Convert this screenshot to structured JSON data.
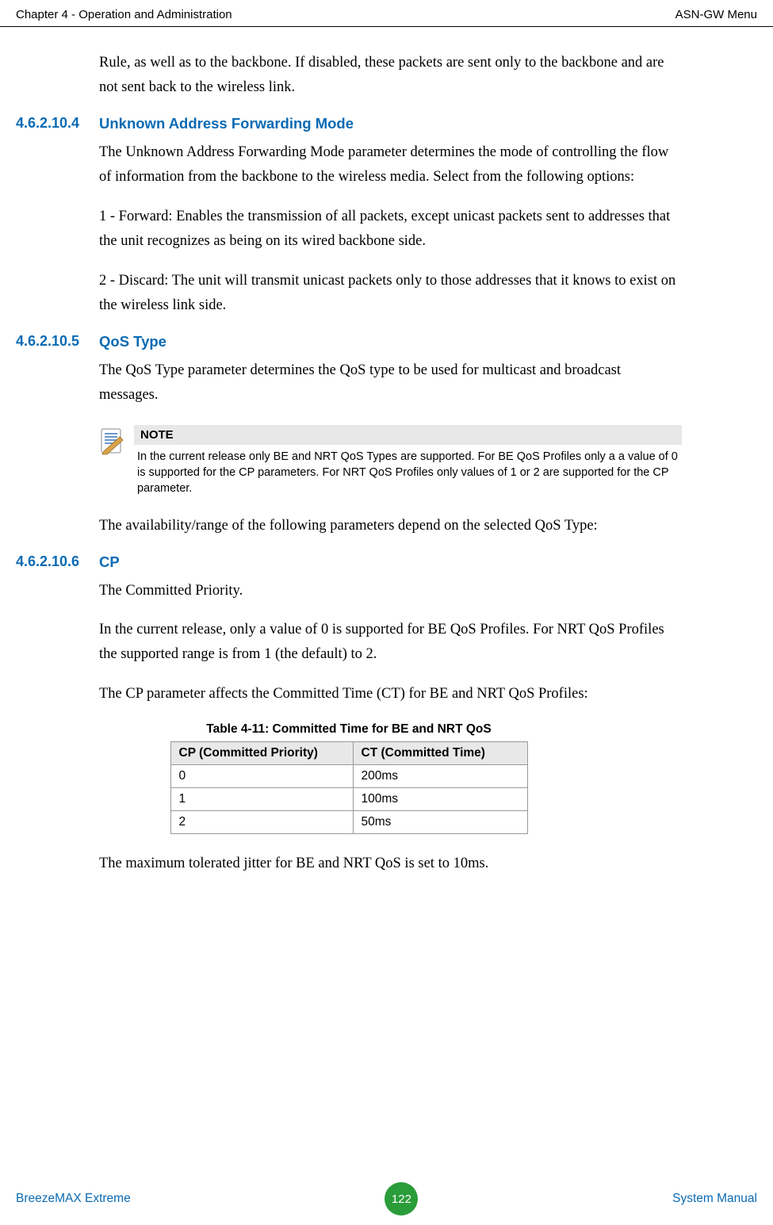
{
  "header": {
    "left": "Chapter 4 - Operation and Administration",
    "right": "ASN-GW Menu"
  },
  "intro_para": "Rule, as well as to the backbone. If disabled, these packets are sent only to the backbone and are not sent back to the wireless link.",
  "sections": {
    "s4": {
      "num": "4.6.2.10.4",
      "title": "Unknown Address Forwarding Mode",
      "p1": "The Unknown Address Forwarding Mode parameter determines the mode of controlling the flow of information from the backbone to the wireless media. Select from the following options:",
      "p2": "1 - Forward: Enables the transmission of all packets, except unicast packets sent to addresses that the unit recognizes as being on its wired backbone side.",
      "p3": "2 - Discard: The unit will transmit unicast packets only to those addresses that it knows to exist on the wireless link side."
    },
    "s5": {
      "num": "4.6.2.10.5",
      "title": "QoS Type",
      "p1": "The QoS Type parameter determines the QoS type to be used for multicast and broadcast messages.",
      "note_label": "NOTE",
      "note_body": "In the current release only BE and NRT QoS Types are supported. For BE QoS Profiles only a a value of 0 is supported for the CP parameters. For NRT QoS Profiles only values of 1 or 2 are supported for the CP parameter.",
      "p2": "The availability/range of the following parameters depend on the selected QoS Type:"
    },
    "s6": {
      "num": "4.6.2.10.6",
      "title": "CP",
      "p1": "The Committed Priority.",
      "p2": "In the current release, only a value of 0 is supported for BE QoS Profiles. For NRT QoS Profiles the supported range is from 1 (the default) to 2.",
      "p3": "The CP parameter affects the Committed Time (CT) for BE and NRT QoS Profiles:",
      "p4": "The maximum tolerated jitter for BE and NRT QoS is set to 10ms."
    }
  },
  "table": {
    "caption": "Table 4-11: Committed Time for BE and NRT QoS",
    "headers": [
      "CP (Committed Priority)",
      "CT (Committed Time)"
    ],
    "rows": [
      [
        "0",
        "200ms"
      ],
      [
        "1",
        "100ms"
      ],
      [
        "2",
        "50ms"
      ]
    ]
  },
  "footer": {
    "left": "BreezeMAX Extreme",
    "page": "122",
    "right": "System Manual"
  }
}
